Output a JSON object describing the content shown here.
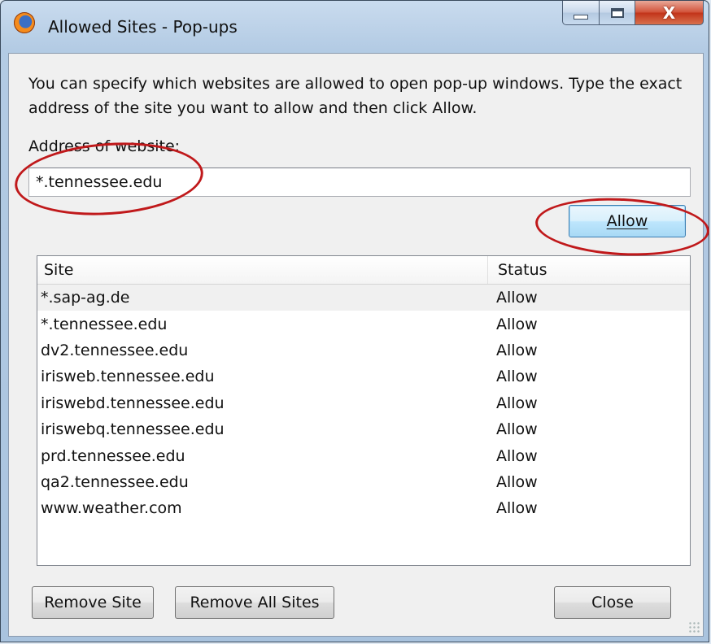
{
  "window": {
    "title": "Allowed Sites - Pop-ups",
    "close_glyph": "X"
  },
  "dialog": {
    "intro_text": "You can specify which websites are allowed to open pop-up windows. Type the exact address of the site you want to allow and then click Allow.",
    "address_label": "Address of website:",
    "address_value": "*.tennessee.edu",
    "allow_button": "Allow"
  },
  "list": {
    "columns": [
      "Site",
      "Status"
    ],
    "rows": [
      {
        "site": "*.sap-ag.de",
        "status": "Allow"
      },
      {
        "site": "*.tennessee.edu",
        "status": "Allow"
      },
      {
        "site": "dv2.tennessee.edu",
        "status": "Allow"
      },
      {
        "site": "irisweb.tennessee.edu",
        "status": "Allow"
      },
      {
        "site": "iriswebd.tennessee.edu",
        "status": "Allow"
      },
      {
        "site": "iriswebq.tennessee.edu",
        "status": "Allow"
      },
      {
        "site": "prd.tennessee.edu",
        "status": "Allow"
      },
      {
        "site": "qa2.tennessee.edu",
        "status": "Allow"
      },
      {
        "site": "www.weather.com",
        "status": "Allow"
      }
    ]
  },
  "footer": {
    "remove_site": "Remove Site",
    "remove_all_sites": "Remove All Sites",
    "close": "Close"
  },
  "icons": {
    "app": "firefox-icon",
    "minimize": "minimize-icon",
    "maximize": "maximize-icon",
    "close": "close-icon"
  },
  "colors": {
    "annotation": "#c0191b",
    "default_button_border": "#3c7fb1",
    "close_caption": "#c2341a"
  }
}
